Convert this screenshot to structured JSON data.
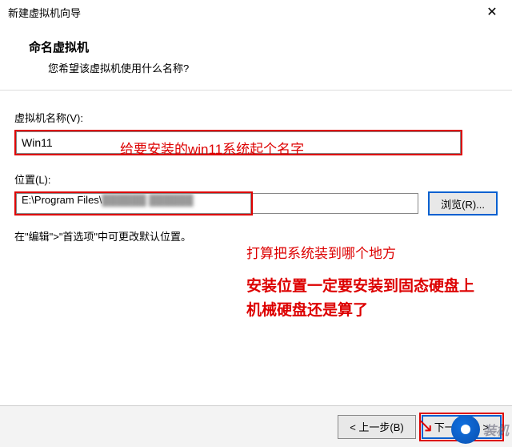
{
  "window": {
    "title": "新建虚拟机向导",
    "close": "✕"
  },
  "header": {
    "title": "命名虚拟机",
    "subtitle": "您希望该虚拟机使用什么名称?"
  },
  "nameField": {
    "label": "虚拟机名称(V):",
    "value": "Win11"
  },
  "locationField": {
    "label": "位置(L):",
    "value": "E:\\Program Files\\",
    "blurredPart": "██████ ██████"
  },
  "browseBtn": "浏览(R)...",
  "helperText": "在\"编辑\">\"首选项\"中可更改默认位置。",
  "annotations": {
    "name": "给要安装的win11系统起个名字",
    "location": "打算把系统装到哪个地方",
    "warning1": "安装位置一定要安装到固态硬盘上",
    "warning2": "机械硬盘还是算了"
  },
  "footer": {
    "back": "< 上一步(B)",
    "next": "下一步(N) >"
  },
  "watermark": "装机"
}
